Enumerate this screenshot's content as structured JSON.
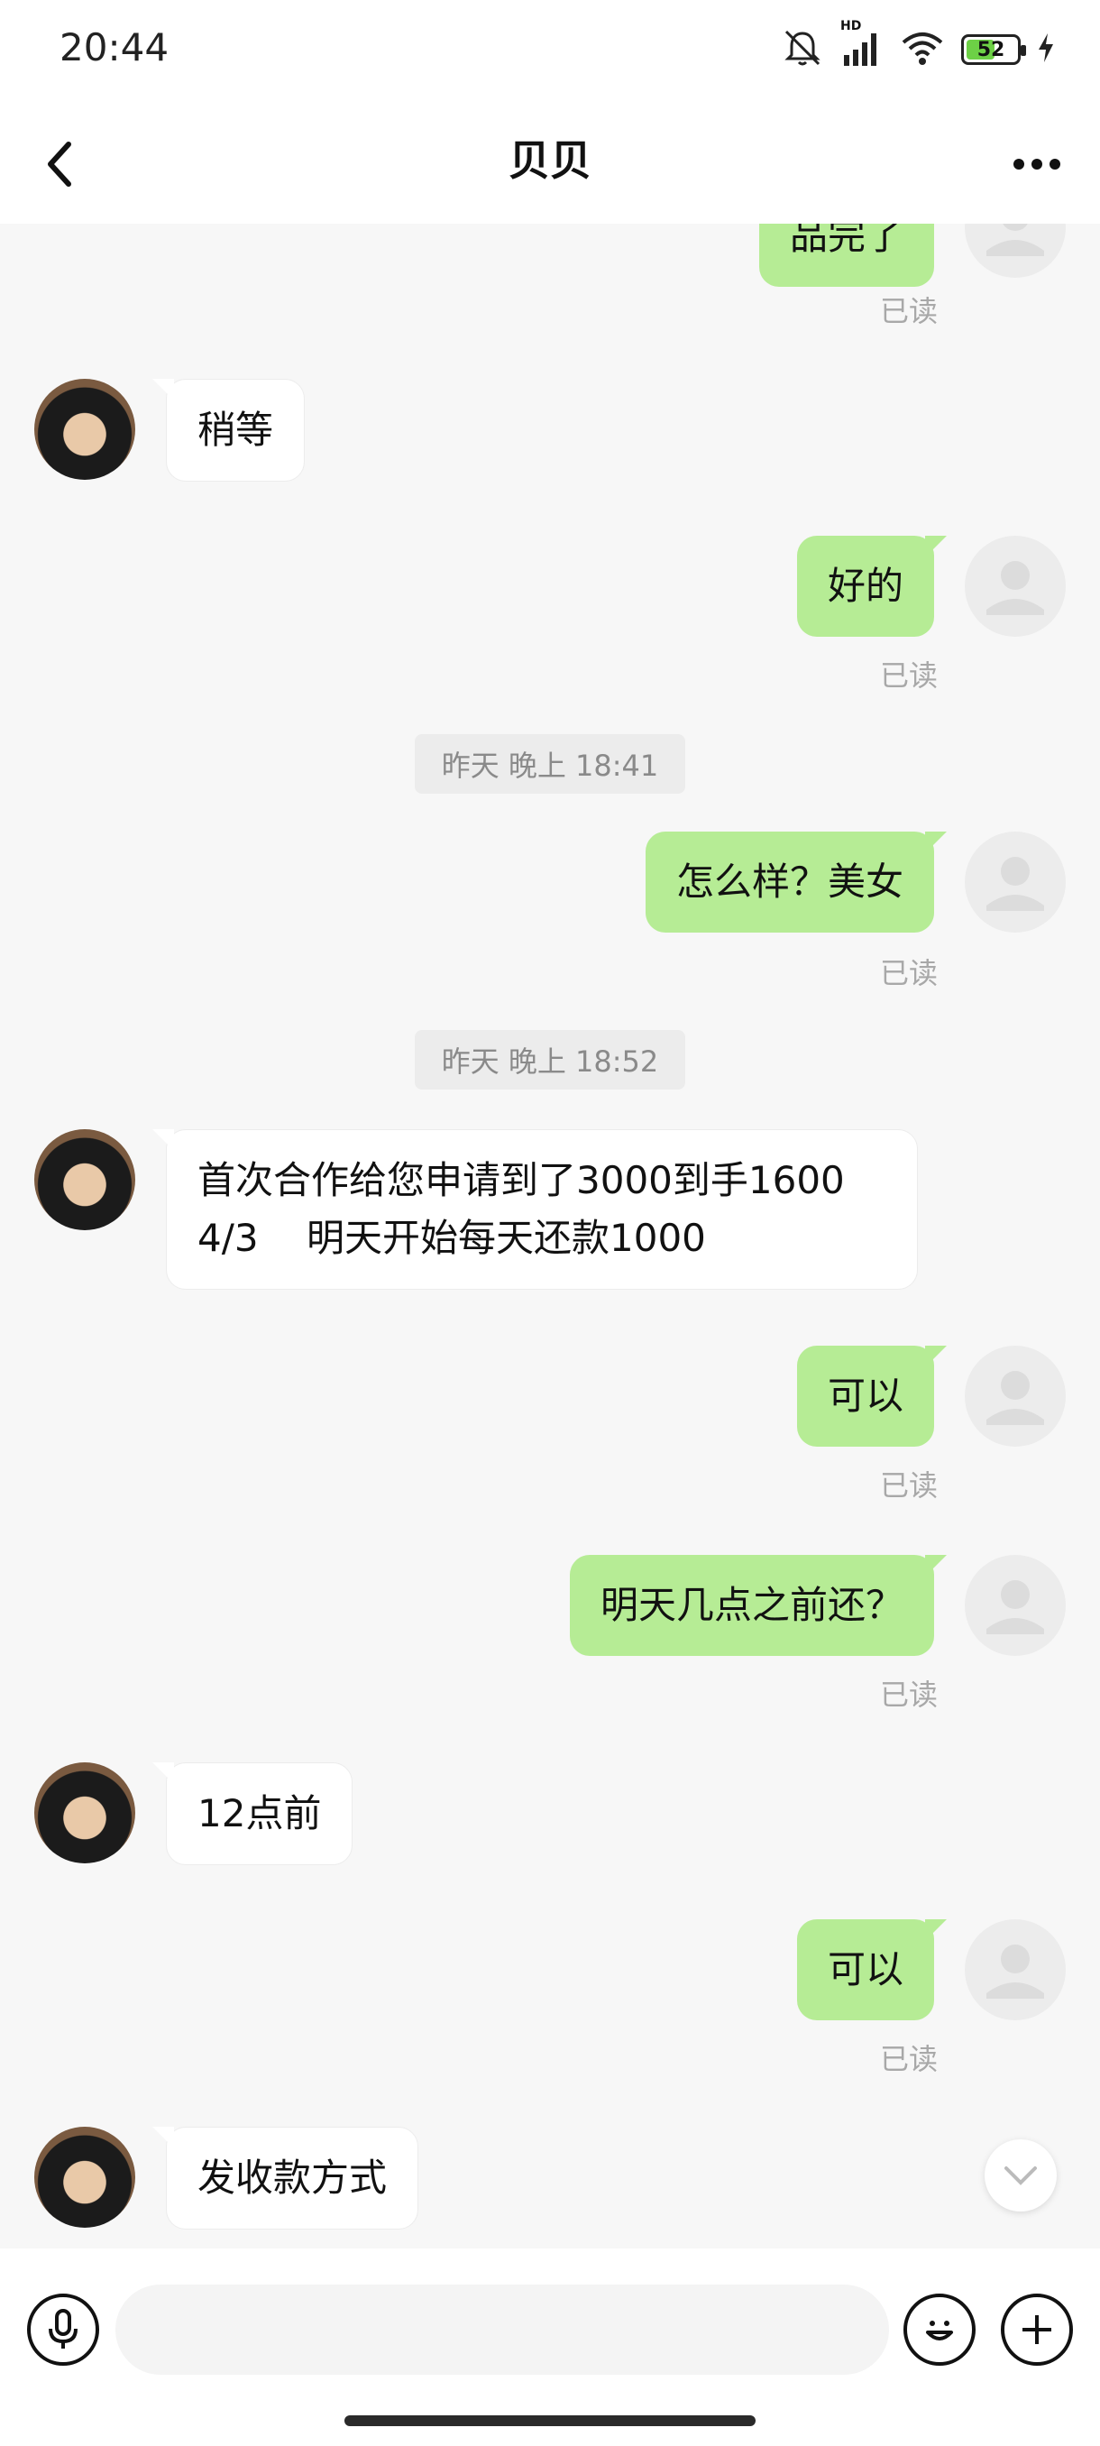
{
  "status": {
    "time": "20:44",
    "battery": "52",
    "hd_label": "HD"
  },
  "header": {
    "title": "贝贝"
  },
  "messages": {
    "m0": {
      "text": "品完了",
      "read": "已读"
    },
    "m1": {
      "text": "稍等"
    },
    "m2": {
      "text": "好的",
      "read": "已读"
    },
    "ts1": "昨天 晚上 18:41",
    "m3": {
      "text": "怎么样？美女",
      "read": "已读"
    },
    "ts2": "昨天 晚上 18:52",
    "m4": {
      "line1": "首次合作给您申请到了3000到手1600",
      "line2": "4/3    明天开始每天还款1000"
    },
    "m5": {
      "text": "可以",
      "read": "已读"
    },
    "m6": {
      "text": "明天几点之前还？",
      "read": "已读"
    },
    "m7": {
      "text": "12点前"
    },
    "m8": {
      "text": "可以",
      "read": "已读"
    },
    "m9": {
      "text": "发收款方式"
    }
  },
  "input": {
    "placeholder": ""
  },
  "colors": {
    "outgoing_bubble": "#b6ec95",
    "incoming_bubble": "#ffffff",
    "background": "#f7f7f7"
  }
}
